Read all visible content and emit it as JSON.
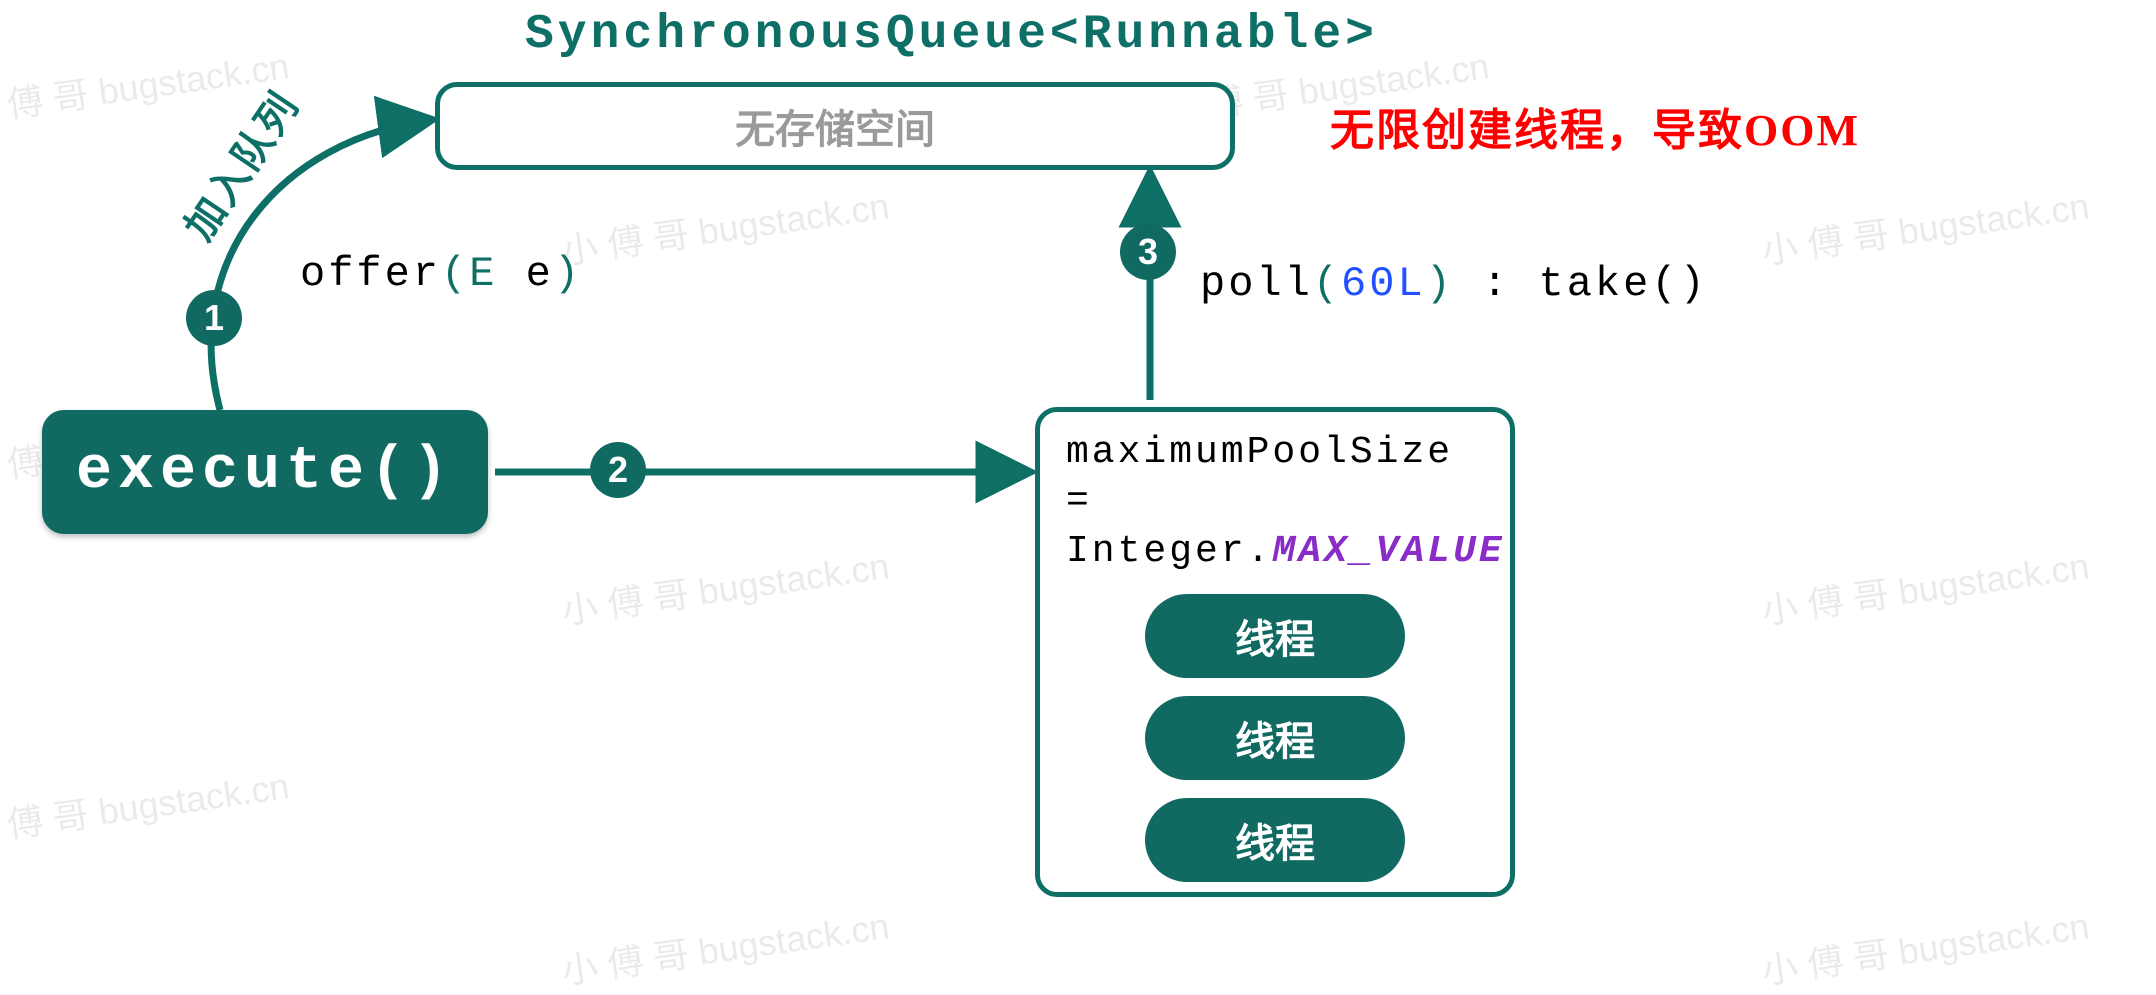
{
  "watermark": "小 傅 哥 bugstack.cn",
  "queue": {
    "title": "SynchronousQueue<Runnable>",
    "body": "无存储空间"
  },
  "execute": {
    "label": "execute()"
  },
  "pool": {
    "line1": "maximumPoolSize =",
    "line2_prefix": "Integer.",
    "line2_value": "MAX_VALUE",
    "thread_label": "线程"
  },
  "steps": {
    "1": {
      "num": "1",
      "label": "加入队列"
    },
    "2": {
      "num": "2"
    },
    "3": {
      "num": "3"
    }
  },
  "offer": {
    "word": "offer",
    "paren_open": "(",
    "type": "E",
    "arg": " e",
    "paren_close": ")"
  },
  "poll": {
    "word": "poll",
    "paren_open": "(",
    "arg": "60L",
    "paren_close": ")",
    "sep": " : ",
    "take": "take()"
  },
  "warning": "无限创建线程，导致OOM",
  "colors": {
    "teal": "#0d6f66",
    "teal_fill": "#106a62",
    "purple": "#8a2cc7",
    "red": "#ff0000",
    "blue": "#2050ff"
  }
}
